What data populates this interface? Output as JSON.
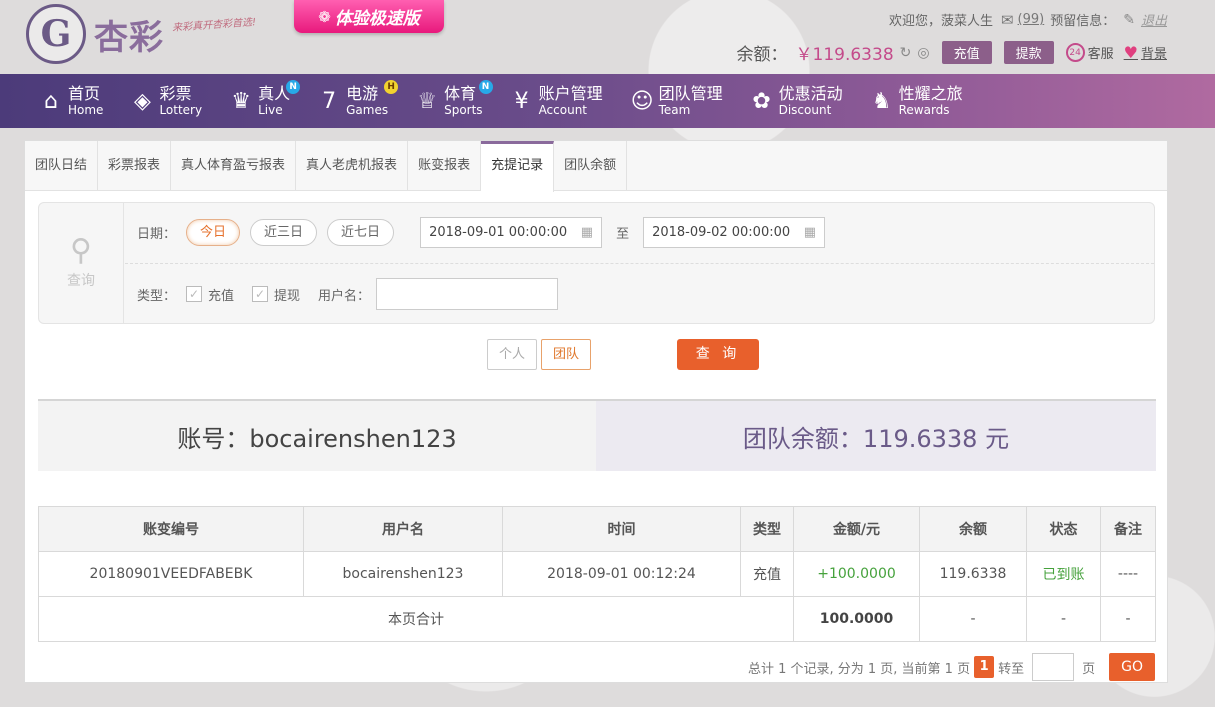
{
  "header": {
    "logo_mark": "G",
    "logo_name": "杏彩",
    "logo_slogan": "来彩真开杏彩首选!",
    "promo_label": "体验极速版",
    "greeting": "欢迎您，",
    "username": "菠菜人生",
    "mail_count": "(99)",
    "reserved_label": "预留信息：",
    "logout": "退出",
    "balance_label": "余额：",
    "balance_value": "￥119.6338",
    "recharge_btn": "充值",
    "withdraw_btn": "提款",
    "service_label": "客服",
    "skin_label": "背景"
  },
  "nav": [
    {
      "cn": "首页",
      "en": "Home",
      "icon": "home-icon",
      "glyph": "⌂",
      "badge": ""
    },
    {
      "cn": "彩票",
      "en": "Lottery",
      "icon": "ticket-icon",
      "glyph": "◈",
      "badge": ""
    },
    {
      "cn": "真人",
      "en": "Live",
      "icon": "dealer-icon",
      "glyph": "♛",
      "badge": "N"
    },
    {
      "cn": "电游",
      "en": "Games",
      "icon": "slot-icon",
      "glyph": "7",
      "badge": "H"
    },
    {
      "cn": "体育",
      "en": "Sports",
      "icon": "trophy-icon",
      "glyph": "♕",
      "badge": "N"
    },
    {
      "cn": "账户管理",
      "en": "Account",
      "icon": "account-icon",
      "glyph": "¥",
      "badge": ""
    },
    {
      "cn": "团队管理",
      "en": "Team",
      "icon": "team-icon",
      "glyph": "☺",
      "badge": ""
    },
    {
      "cn": "优惠活动",
      "en": "Discount",
      "icon": "gift-icon",
      "glyph": "✿",
      "badge": ""
    },
    {
      "cn": "性耀之旅",
      "en": "Rewards",
      "icon": "rewards-icon",
      "glyph": "♞",
      "badge": ""
    }
  ],
  "tabs": [
    "团队日结",
    "彩票报表",
    "真人体育盈亏报表",
    "真人老虎机报表",
    "账变报表",
    "充提记录",
    "团队余额"
  ],
  "query": {
    "side_label": "查询",
    "date_label": "日期：",
    "quick": [
      "今日",
      "近三日",
      "近七日"
    ],
    "start": "2018-09-01 00:00:00",
    "to": "至",
    "end": "2018-09-02 00:00:00",
    "type_label": "类型：",
    "type_recharge": "充值",
    "type_withdraw": "提现",
    "user_label": "用户名：",
    "user_value": "",
    "scope_personal": "个人",
    "scope_team": "团队",
    "search_btn": "查 询"
  },
  "summary": {
    "account": "账号：bocairenshen123",
    "team_balance": "团队余额：119.6338 元"
  },
  "table": {
    "headers": [
      "账变编号",
      "用户名",
      "时间",
      "类型",
      "金额/元",
      "余额",
      "状态",
      "备注"
    ],
    "rows": [
      [
        "20180901VEEDFABEBK",
        "bocairenshen123",
        "2018-09-01 00:12:24",
        "充值",
        "+100.0000",
        "119.6338",
        "已到账",
        "----"
      ]
    ],
    "total_label": "本页合计",
    "total_amount": "100.0000",
    "total_rest": [
      "-",
      "-",
      "-"
    ]
  },
  "pager": {
    "summary": "总计 1 个记录, 分为 1 页, 当前第 1 页",
    "current": "1",
    "goto_label": "转至",
    "page_unit": "页",
    "go_btn": "GO"
  },
  "colors": {
    "nav_start": "#4c3b7a",
    "nav_end": "#b06aa0",
    "accent_orange": "#e8602c",
    "balance_pink": "#c44b8b",
    "success_green": "#46a23c"
  }
}
